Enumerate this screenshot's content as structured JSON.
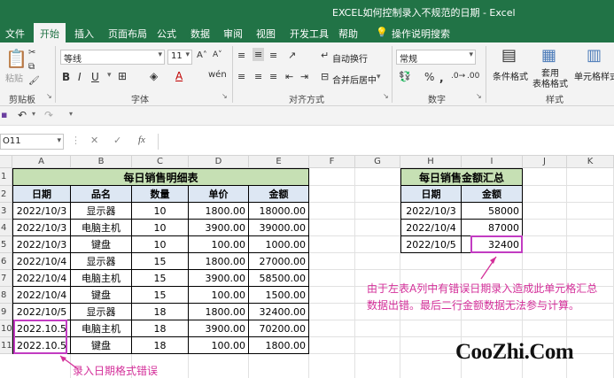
{
  "window": {
    "title": "EXCEL如何控制录入不规范的日期 - Excel"
  },
  "tabs": [
    "文件",
    "开始",
    "插入",
    "页面布局",
    "公式",
    "数据",
    "审阅",
    "视图",
    "开发工具",
    "帮助",
    "操作说明搜索"
  ],
  "ribbon": {
    "clipboard": {
      "paste": "粘贴",
      "label": "剪贴板"
    },
    "font": {
      "name": "等线",
      "size": "11",
      "label": "字体"
    },
    "alignment": {
      "wrap": "自动换行",
      "merge": "合并后居中",
      "label": "对齐方式"
    },
    "number": {
      "format": "常规",
      "label": "数字"
    },
    "styles": {
      "conditional": "条件格式",
      "table": "套用\n表格格式",
      "cell": "单元格样式",
      "label": "样式"
    }
  },
  "formula_bar": {
    "name_box": "O11",
    "fx": "fx"
  },
  "columns": [
    "A",
    "B",
    "C",
    "D",
    "E",
    "F",
    "G",
    "H",
    "I",
    "J",
    "K"
  ],
  "rows": [
    "1",
    "2",
    "3",
    "4",
    "5",
    "6",
    "7",
    "8",
    "9",
    "10",
    "11"
  ],
  "table1": {
    "title": "每日销售明细表",
    "headers": [
      "日期",
      "品名",
      "数量",
      "单价",
      "金额"
    ],
    "rows": [
      [
        "2022/10/3",
        "显示器",
        "10",
        "1800.00",
        "18000.00"
      ],
      [
        "2022/10/3",
        "电脑主机",
        "10",
        "3900.00",
        "39000.00"
      ],
      [
        "2022/10/3",
        "键盘",
        "10",
        "100.00",
        "1000.00"
      ],
      [
        "2022/10/4",
        "显示器",
        "15",
        "1800.00",
        "27000.00"
      ],
      [
        "2022/10/4",
        "电脑主机",
        "15",
        "3900.00",
        "58500.00"
      ],
      [
        "2022/10/4",
        "键盘",
        "15",
        "100.00",
        "1500.00"
      ],
      [
        "2022/10/5",
        "显示器",
        "18",
        "1800.00",
        "32400.00"
      ],
      [
        "2022.10.5",
        "电脑主机",
        "18",
        "3900.00",
        "70200.00"
      ],
      [
        "2022.10.5",
        "键盘",
        "18",
        "100.00",
        "1800.00"
      ]
    ]
  },
  "table2": {
    "title": "每日销售金额汇总",
    "headers": [
      "日期",
      "金额"
    ],
    "rows": [
      [
        "2022/10/3",
        "58000"
      ],
      [
        "2022/10/4",
        "87000"
      ],
      [
        "2022/10/5",
        "32400"
      ]
    ]
  },
  "annotations": {
    "right": "由于左表A列中有错误日期录入造成此单元格汇总数据出错。最后二行金额数据无法参与计算。",
    "bottom": "录入日期格式错误"
  },
  "watermark": "CooZhi.Com",
  "colors": {
    "excel_green": "#217346",
    "highlight": "#c23cc2",
    "annotation": "#d4309a"
  }
}
